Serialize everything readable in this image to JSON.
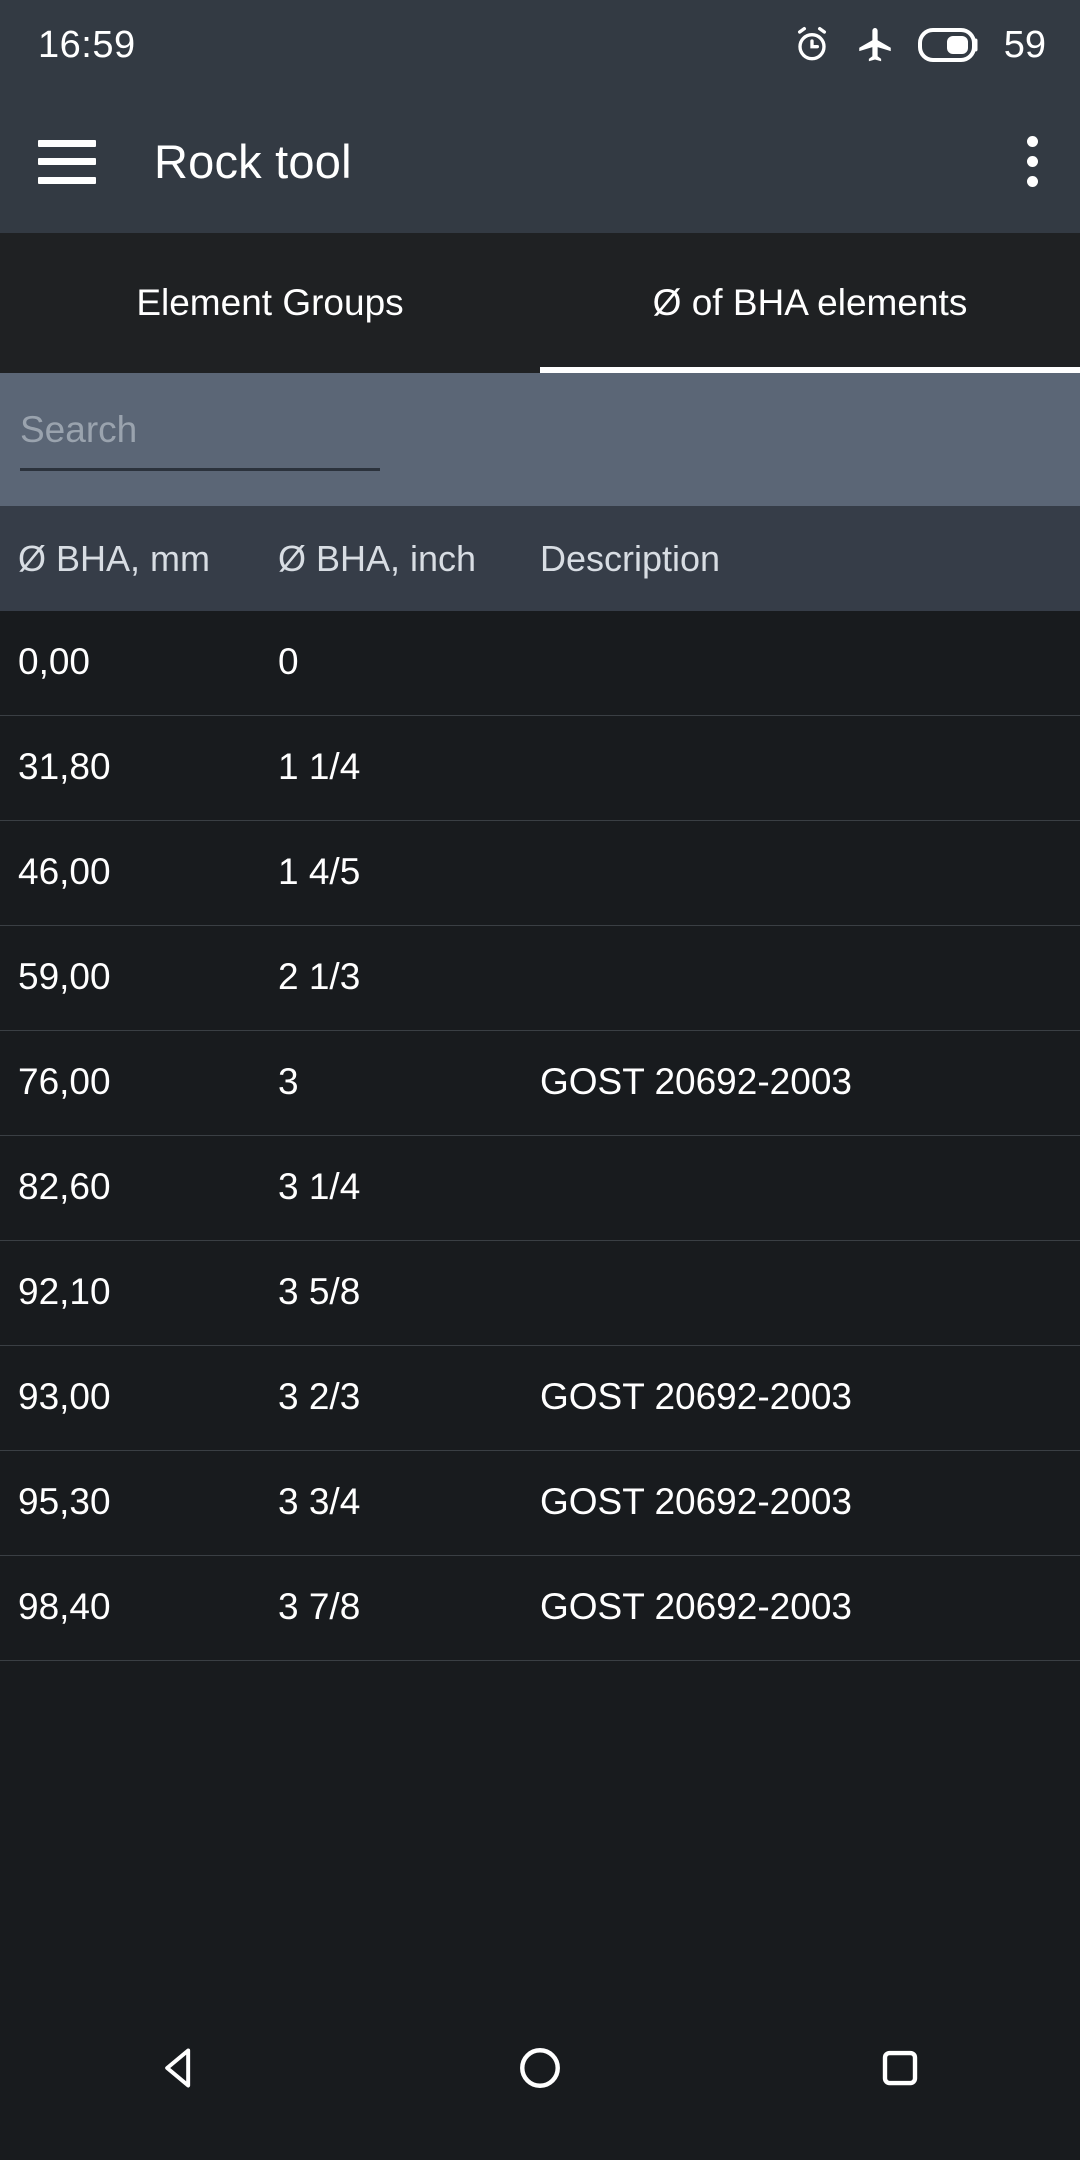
{
  "status_bar": {
    "time": "16:59",
    "battery_percent": "59",
    "icons": [
      "alarm-icon",
      "airplane-mode-icon",
      "battery-icon"
    ]
  },
  "app_bar": {
    "title": "Rock tool",
    "menu_icon": "hamburger-menu-icon",
    "overflow_icon": "more-options-icon"
  },
  "tabs": [
    {
      "label": "Element Groups",
      "active": false
    },
    {
      "label": "Ø of BHA elements",
      "active": true
    }
  ],
  "search": {
    "placeholder": "Search",
    "value": ""
  },
  "table": {
    "columns": [
      "Ø BHA, mm",
      "Ø BHA, inch",
      "Description"
    ],
    "rows": [
      {
        "mm": "0,00",
        "inch": "0",
        "description": ""
      },
      {
        "mm": "31,80",
        "inch": "1 1/4",
        "description": ""
      },
      {
        "mm": "46,00",
        "inch": "1 4/5",
        "description": ""
      },
      {
        "mm": "59,00",
        "inch": "2 1/3",
        "description": ""
      },
      {
        "mm": "76,00",
        "inch": "3",
        "description": "GOST 20692-2003"
      },
      {
        "mm": "82,60",
        "inch": "3 1/4",
        "description": ""
      },
      {
        "mm": "92,10",
        "inch": "3 5/8",
        "description": ""
      },
      {
        "mm": "93,00",
        "inch": "3 2/3",
        "description": "GOST 20692-2003"
      },
      {
        "mm": "95,30",
        "inch": "3 3/4",
        "description": "GOST 20692-2003"
      },
      {
        "mm": "98,40",
        "inch": "3 7/8",
        "description": "GOST 20692-2003"
      }
    ]
  },
  "nav_bar": {
    "back": "back-nav-icon",
    "home": "home-nav-icon",
    "recents": "recents-nav-icon"
  },
  "colors": {
    "status_bar_bg": "#333a43",
    "tab_bar_bg": "#1f2123",
    "search_bg": "#5b6676",
    "table_header_bg": "#363d48",
    "table_row_bg": "#181b1e",
    "accent": "#ffffff"
  }
}
